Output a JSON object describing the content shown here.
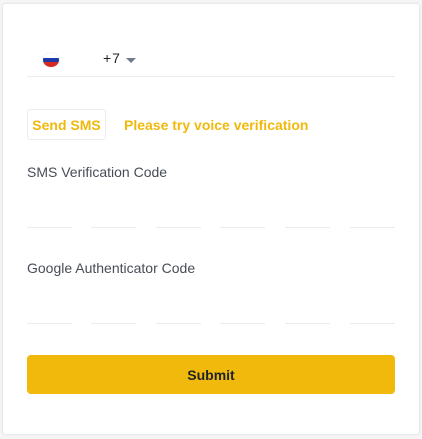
{
  "phone": {
    "flag_icon": "russia-flag-icon",
    "country_code": "+7",
    "number_value": "",
    "caret_icon": "chevron-down-icon"
  },
  "sms": {
    "send_label": "Send SMS",
    "voice_label": "Please try voice verification"
  },
  "sms_code": {
    "label": "SMS Verification Code",
    "digits": [
      "",
      "",
      "",
      "",
      "",
      ""
    ]
  },
  "ga_code": {
    "label": "Google Authenticator Code",
    "digits": [
      "",
      "",
      "",
      "",
      "",
      ""
    ]
  },
  "submit_label": "Submit",
  "colors": {
    "accent": "#f0b90b",
    "text": "#1e2329",
    "label": "#474d57",
    "border": "#eaecef"
  }
}
